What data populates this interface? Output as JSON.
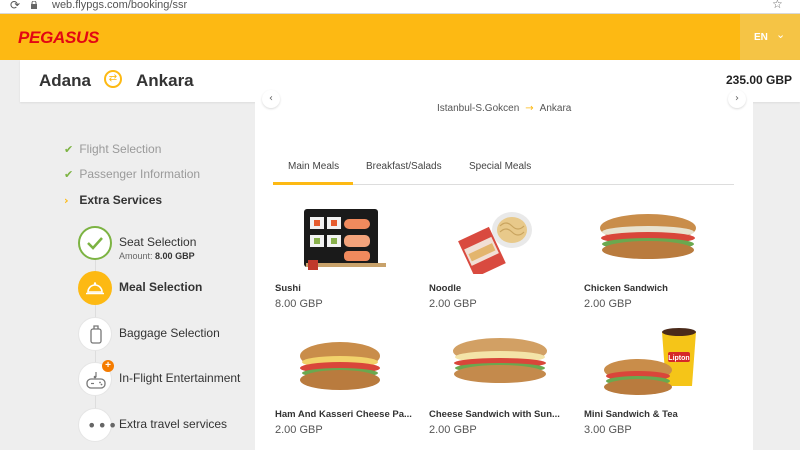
{
  "browser": {
    "url": "web.flypgs.com/booking/ssr"
  },
  "header": {
    "logo": "PEGASUS",
    "lang": "EN"
  },
  "route": {
    "from": "Adana",
    "to": "Ankara",
    "price": "235.00 GBP"
  },
  "steps": [
    {
      "label": "Flight Selection",
      "mark": "✔"
    },
    {
      "label": "Passenger Information",
      "mark": "✔"
    },
    {
      "label": "Extra Services",
      "mark": "›"
    }
  ],
  "services": [
    {
      "label": "Seat Selection",
      "amount_label": "Amount:",
      "amount": "8.00 GBP"
    },
    {
      "label": "Meal Selection"
    },
    {
      "label": "Baggage Selection"
    },
    {
      "label": "In-Flight Entertainment"
    },
    {
      "label": "Extra travel services"
    }
  ],
  "segment": {
    "from": "Istanbul-S.Gokcen",
    "to": "Ankara"
  },
  "tabs": [
    "Main Meals",
    "Breakfast/Salads",
    "Special Meals"
  ],
  "meals": [
    {
      "name": "Sushi",
      "price": "8.00 GBP"
    },
    {
      "name": "Noodle",
      "price": "2.00 GBP"
    },
    {
      "name": "Chicken Sandwich",
      "price": "2.00 GBP"
    },
    {
      "name": "Ham And Kasseri Cheese Pa...",
      "price": "2.00 GBP"
    },
    {
      "name": "Cheese Sandwich with Sun...",
      "price": "2.00 GBP"
    },
    {
      "name": "Mini Sandwich & Tea",
      "price": "3.00 GBP"
    }
  ],
  "colors": {
    "brand": "#fdb913",
    "logo": "#e30613",
    "check": "#7cb342"
  }
}
